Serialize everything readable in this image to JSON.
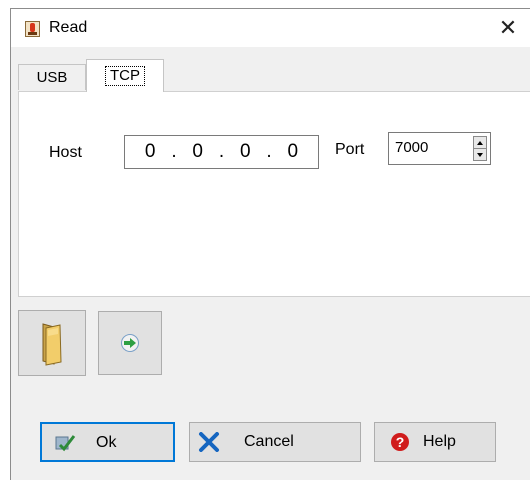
{
  "window": {
    "title": "Read",
    "close_glyph": "✕"
  },
  "tabs": [
    {
      "label": "USB",
      "active": false
    },
    {
      "label": "TCP",
      "active": true
    }
  ],
  "tcp": {
    "host_label": "Host",
    "host_octets": [
      "0",
      "0",
      "0",
      "0"
    ],
    "ip_separator": ".",
    "port_label": "Port",
    "port_value": "7000"
  },
  "toolbar": {
    "folder_icon": "folder-icon",
    "go_icon": "go-arrow-icon"
  },
  "buttons": {
    "ok_label": "Ok",
    "cancel_label": "Cancel",
    "help_label": "Help"
  },
  "colors": {
    "focus_border": "#0078d7",
    "cancel_x": "#1565c0",
    "help_red": "#d01c1c"
  }
}
